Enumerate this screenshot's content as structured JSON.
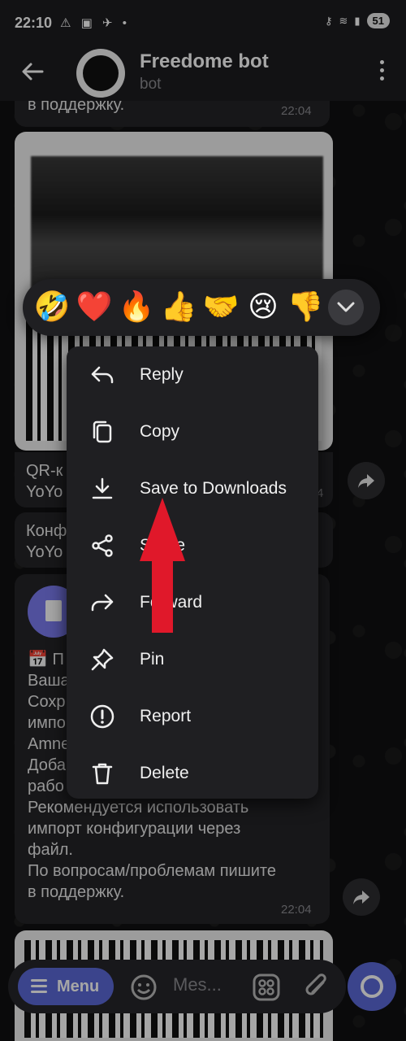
{
  "status_bar": {
    "time": "22:10",
    "battery": "51"
  },
  "header": {
    "title": "Freedome bot",
    "subtitle": "bot"
  },
  "messages": {
    "top_text": "в поддержку.",
    "top_time": "22:04",
    "caption1_line1": "QR-к",
    "caption1_line2": "YoYo",
    "caption1_time": "4",
    "caption2_line1": "Конф",
    "caption2_line2": "YoYo",
    "doc_lines": [
      "📅 П",
      "Ваша",
      "Сохр",
      "импо",
      "Amne",
      "Доба",
      "рабо",
      "Рекомендуется использовать",
      "импорт конфигурации через",
      "файл.",
      "По вопросам/проблемам пишите",
      "в поддержку."
    ],
    "doc_time": "22:04"
  },
  "reactions": [
    "🤣",
    "❤️",
    "🔥",
    "👍",
    "🤝",
    "😢",
    "👎"
  ],
  "context_menu": [
    {
      "label": "Reply",
      "icon": "reply-icon"
    },
    {
      "label": "Copy",
      "icon": "copy-icon"
    },
    {
      "label": "Save to Downloads",
      "icon": "download-icon"
    },
    {
      "label": "Share",
      "icon": "share-icon"
    },
    {
      "label": "Forward",
      "icon": "forward-icon"
    },
    {
      "label": "Pin",
      "icon": "pin-icon"
    },
    {
      "label": "Report",
      "icon": "report-icon"
    },
    {
      "label": "Delete",
      "icon": "trash-icon"
    }
  ],
  "input_bar": {
    "menu_label": "Menu",
    "placeholder": "Mes..."
  },
  "colors": {
    "accent": "#5b69d8",
    "highlight_arrow": "#e0182a",
    "menu_bg": "#1f1f22"
  }
}
